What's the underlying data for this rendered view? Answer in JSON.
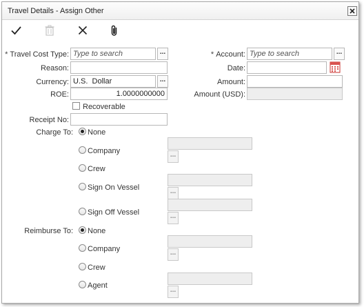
{
  "window": {
    "title": "Travel Details - Assign Other"
  },
  "toolbar": {
    "save_icon": "check-icon",
    "delete_icon": "trash-icon",
    "cancel_icon": "close-icon",
    "attach_icon": "paperclip-icon"
  },
  "form": {
    "travel_cost_type": {
      "label": "Travel Cost Type:",
      "placeholder": "Type to search",
      "required_mark": "*"
    },
    "account": {
      "label": "Account:",
      "placeholder": "Type to search",
      "required_mark": "*"
    },
    "reason": {
      "label": "Reason:",
      "value": ""
    },
    "date": {
      "label": "Date:",
      "value": ""
    },
    "currency": {
      "label": "Currency:",
      "value": "U.S.  Dollar"
    },
    "amount": {
      "label": "Amount:",
      "value": ""
    },
    "roe": {
      "label": "ROE:",
      "value": "1.0000000000"
    },
    "amount_usd": {
      "label": "Amount (USD):",
      "value": ""
    },
    "recoverable": {
      "label": "Recoverable",
      "checked": false
    },
    "receipt_no": {
      "label": "Receipt No:",
      "value": ""
    },
    "lookup_button": "...",
    "charge_to": {
      "label": "Charge To:",
      "selected": "None",
      "options": [
        "None",
        "Company",
        "Crew",
        "Sign On Vessel",
        "Sign Off Vessel"
      ]
    },
    "reimburse_to": {
      "label": "Reimburse To:",
      "selected": "None",
      "options": [
        "None",
        "Company",
        "Crew",
        "Agent"
      ]
    }
  },
  "colors": {
    "calendar_accent": "#d9534f",
    "border": "#b7b7b7",
    "disabled_bg": "#eeeeee"
  }
}
